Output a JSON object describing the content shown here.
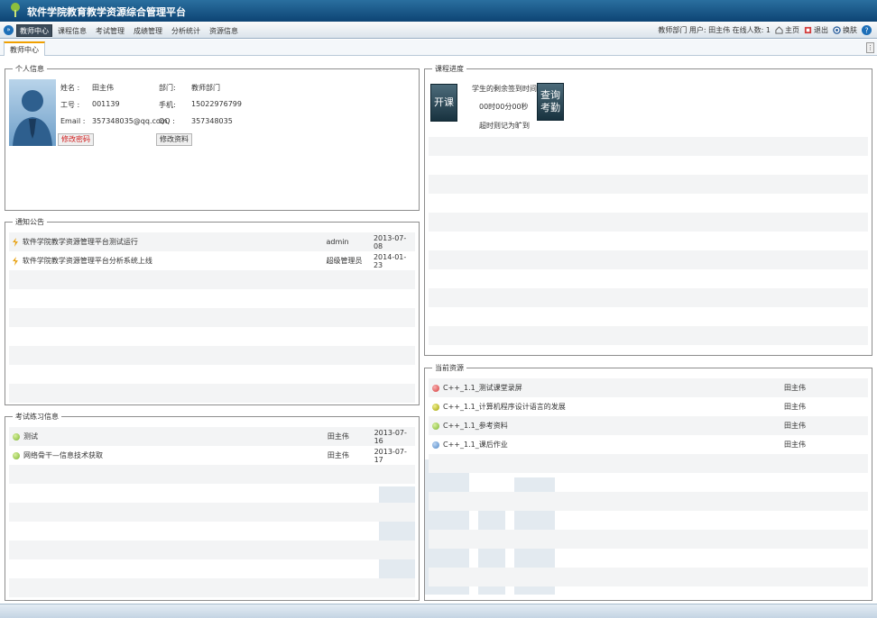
{
  "header": {
    "title": "软件学院教育教学资源综合管理平台"
  },
  "menu": {
    "items": [
      "教师中心",
      "课程信息",
      "考试管理",
      "成绩管理",
      "分析统计",
      "资源信息"
    ],
    "user_info": "教师部门 用户: 田主伟 在线人数: 1",
    "home": "主页",
    "logout": "退出",
    "skin": "换肤"
  },
  "tabs": {
    "home": "教师中心"
  },
  "profile": {
    "legend": "个人信息",
    "name_label": "姓名 :",
    "name": "田主伟",
    "dept_label": "部门:",
    "dept": "教师部门",
    "id_label": "工号 :",
    "id": "001139",
    "phone_label": "手机:",
    "phone": "15022976799",
    "email_label": "Email :",
    "email": "357348035@qq.com",
    "qq_label": "QQ :",
    "qq": "357348035",
    "change_pwd": "修改密码",
    "edit_info": "修改资料"
  },
  "course": {
    "legend": "课程进度",
    "start_btn": "开课",
    "sign_title": "学生的剩余签到时间",
    "countdown": "00时00分00秒",
    "note": "超时则记为旷到",
    "check_btn": "查询考勤"
  },
  "notices": {
    "legend": "通知公告",
    "rows": [
      {
        "title": "软件学院教学资源管理平台测试运行",
        "author": "admin",
        "date": "2013-07-08"
      },
      {
        "title": "软件学院教学资源管理平台分析系统上线",
        "author": "超级管理员",
        "date": "2014-01-23"
      }
    ]
  },
  "exams": {
    "legend": "考试练习信息",
    "rows": [
      {
        "title": "测试",
        "author": "田主伟",
        "date": "2013-07-16"
      },
      {
        "title": "网络骨干—信息技术获取",
        "author": "田主伟",
        "date": "2013-07-17"
      }
    ]
  },
  "resources": {
    "legend": "当前资源",
    "rows": [
      {
        "title": "C++_1.1_测试课堂录屏",
        "owner": "田主伟",
        "color": "#d63a3a"
      },
      {
        "title": "C++_1.1_计算机程序设计语言的发展",
        "owner": "田主伟",
        "color": "#b8b800"
      },
      {
        "title": "C++_1.1_参考资料",
        "owner": "田主伟",
        "color": "#8cc040"
      },
      {
        "title": "C++_1.1_课后作业",
        "owner": "田主伟",
        "color": "#4f86c6"
      }
    ]
  },
  "colors": {
    "accent": "#0d4474",
    "active_tab": "#3c4b5a",
    "stripe": "#f3f4f5"
  }
}
